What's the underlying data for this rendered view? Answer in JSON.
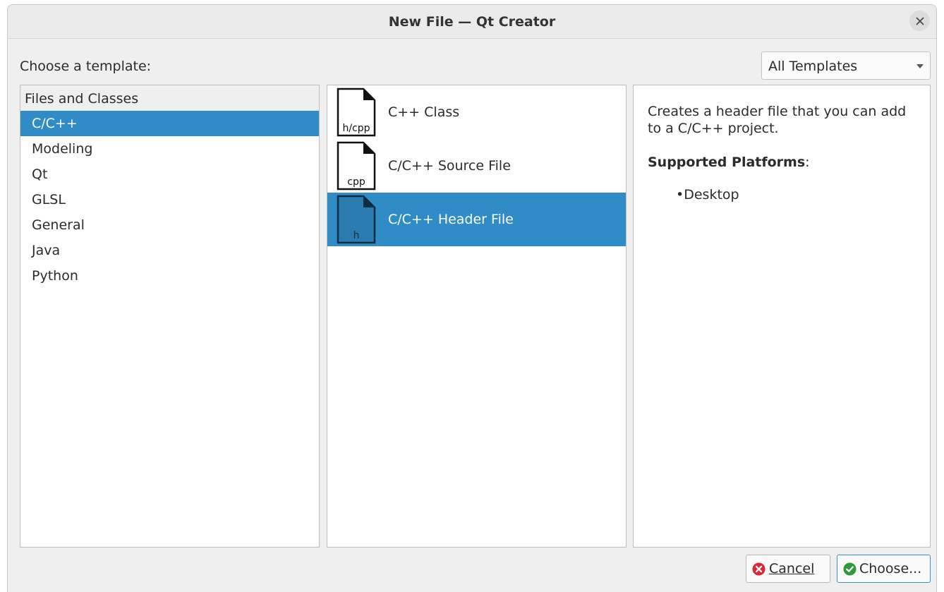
{
  "window": {
    "title": "New File — Qt Creator"
  },
  "prompt_label": "Choose a template:",
  "filter": {
    "selected": "All Templates"
  },
  "categories": {
    "header": "Files and Classes",
    "items": [
      "C/C++",
      "Modeling",
      "Qt",
      "GLSL",
      "General",
      "Java",
      "Python"
    ],
    "selected_index": 0
  },
  "templates": {
    "items": [
      {
        "name": "C++ Class",
        "icon_label": "h/cpp"
      },
      {
        "name": "C/C++ Source File",
        "icon_label": "cpp"
      },
      {
        "name": "C/C++ Header File",
        "icon_label": "h"
      }
    ],
    "selected_index": 2
  },
  "description": {
    "text": "Creates a header file that you can add to a C/C++ project.",
    "platforms_label": "Supported Platforms",
    "platforms_colon": ":",
    "platforms": [
      "Desktop"
    ]
  },
  "buttons": {
    "cancel_label": "Cancel",
    "choose_label": "Choose..."
  },
  "colors": {
    "selection": "#308cc6",
    "cancel_icon": "#d8283b",
    "choose_icon": "#2e9b3a"
  },
  "icons": {
    "close": "close-icon",
    "dropdown": "chevron-down-icon",
    "file": "file-icon",
    "cancel": "cancel-icon",
    "choose": "check-icon"
  }
}
